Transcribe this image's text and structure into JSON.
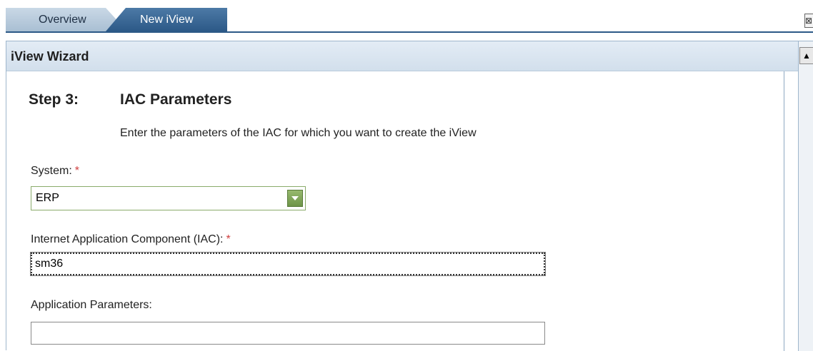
{
  "tabs": {
    "overview_label": "Overview",
    "new_iview_label": "New iView"
  },
  "corner_icon": "maximize-icon",
  "wizard": {
    "title": "iView Wizard",
    "step_number": "Step 3:",
    "step_title": "IAC Parameters",
    "step_description": "Enter the parameters of the IAC for which you want to create the iView",
    "required_marker": "*",
    "fields": {
      "system": {
        "label": "System:",
        "value": "ERP"
      },
      "iac": {
        "label": "Internet Application Component (IAC):",
        "value": "sm36"
      },
      "app_params": {
        "label": "Application Parameters:",
        "value": ""
      }
    }
  },
  "colors": {
    "active_tab": "#2c5987",
    "inactive_tab": "#a9bfd3",
    "header_bg": "#d2dfec",
    "required": "#d04040",
    "dropdown_button": "#6d9448"
  }
}
